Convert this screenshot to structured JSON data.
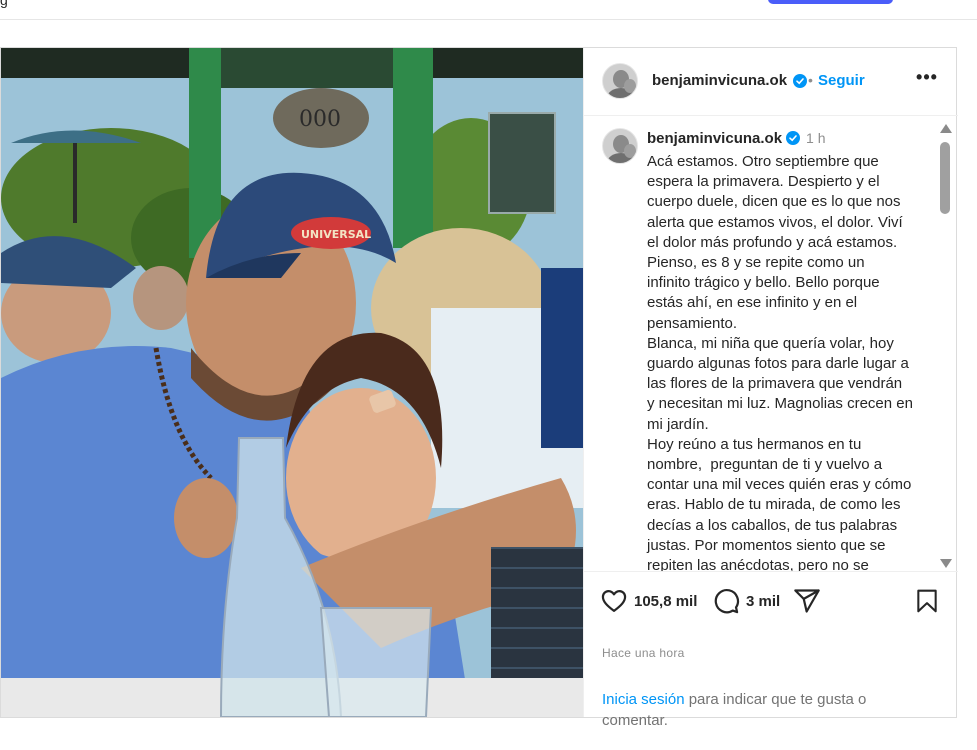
{
  "topbar": {
    "glyph": "g"
  },
  "post": {
    "author": {
      "username": "benjaminvicuna.ok",
      "verified": true,
      "follow_label": "Seguir",
      "separator": "•",
      "more_label": "•••"
    },
    "caption": {
      "username": "benjaminvicuna.ok",
      "time": "1 h",
      "text": "Acá estamos. Otro septiembre que\nespera la primavera. Despierto y el\ncuerpo duele, dicen que es lo que nos\nalerta que estamos vivos, el dolor. Viví\nel dolor más profundo y acá estamos.\nPienso, es 8 y se repite como un\ninfinito trágico y bello. Bello porque\nestás ahí, en ese infinito y en el\npensamiento.\nBlanca, mi niña que quería volar, hoy\nguardo algunas fotos para darle lugar a\nlas flores de la primavera que vendrán\ny necesitan mi luz. Magnolias crecen en\nmi jardín.\nHoy reúno a tus hermanos en tu\nnombre,  preguntan de ti y vuelvo a\ncontar una mil veces quién eras y cómo\neras. Hablo de tu mirada, de como les\ndecías a los caballos, de tus palabras\njustas. Por momentos siento que se\nrepiten las anécdotas, pero no se"
    },
    "stats": {
      "likes": "105,8 mil",
      "comments": "3 mil"
    },
    "time_ago": "Hace una hora",
    "login": {
      "link": "Inicia sesión",
      "text": " para indicar que te gusta o comentar."
    },
    "photo": {
      "cap_text": "UNIVERSAL",
      "sign_text": "000"
    }
  },
  "icons": [
    "verified-badge-icon",
    "more-options-icon",
    "heart-icon",
    "comment-bubble-icon",
    "share-send-icon",
    "bookmark-icon"
  ],
  "colors": {
    "link_blue": "#0095f6",
    "verified_blue": "#0095f6",
    "text": "#262626",
    "muted": "#8e8e8e"
  }
}
